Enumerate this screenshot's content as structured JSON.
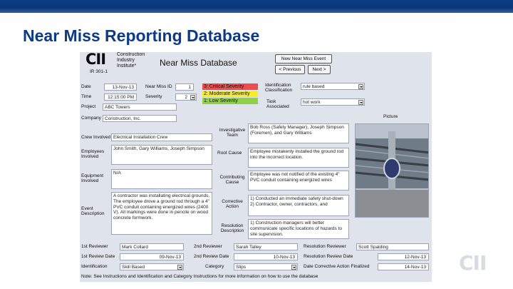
{
  "slide": {
    "title": "Near Miss Reporting Database",
    "corner_logo": "CII"
  },
  "header": {
    "logo_mark": "CII",
    "logo_lines": [
      "Construction",
      "Industry",
      "Institute*"
    ],
    "form_code": "IR 301-1",
    "form_title": "Near Miss Database",
    "buttons": {
      "new_event": "New Near Miss Event",
      "previous": "< Previous",
      "next": "Next >"
    }
  },
  "fields": {
    "date_label": "Date",
    "date": "13-Nov-13",
    "near_miss_id_label": "Near Miss ID",
    "near_miss_id": "1",
    "time_label": "Time",
    "time": "12:15:00 PM",
    "severity_label": "Severity",
    "severity": "2",
    "project_label": "Project",
    "project": "ABC Towers",
    "company_label": "Company",
    "company": "Construction, Inc.",
    "identification_classification_label": "Identification Classification",
    "identification_classification": "rule based",
    "task_associated_label": "Task Associated",
    "task_associated": "hot work"
  },
  "severity_legend": [
    {
      "label": "3: Critical Severity",
      "color": "#ef4d4d"
    },
    {
      "label": "2: Moderate Severity",
      "color": "#f7ee2a"
    },
    {
      "label": "1: Low Severity",
      "color": "#8fd247"
    }
  ],
  "picture": {
    "label": "Picture"
  },
  "left_column": {
    "crew_involved_label": "Crew Involved",
    "crew_involved": "Electrical Installation Crew",
    "employees_involved_label": "Employees Involved",
    "employees_involved": "John Smith, Gary Williams, Joseph Simpson",
    "equipment_involved_label": "Equipment Involved",
    "equipment_involved": "N/A",
    "event_description_label": "Event Description",
    "event_description": "A contractor was installating electrical grounds. The employee drove a ground rod through a 4\" PVC conduit containing energized wires (2400 V). All markings were done in pencile on wood concrete formwork."
  },
  "middle_column": {
    "investigative_team_label": "Investigative Team",
    "investigative_team": "Bob Ross (Safety Manager), Joseph Simpson (Foremen), and Gary Williams",
    "root_cause_label": "Root Cause",
    "root_cause": "Employee mistakenly installed the ground rod into the incorrect location.",
    "contributing_cause_label": "Contributing Cause",
    "contributing_cause": "Employee was not notified of the existing 4\" PVC conduit containing energized wires",
    "corrective_action_label": "Corrective Action",
    "corrective_action": "1) Conducted an immediate safety shut-down\n2) Contractor, owner, contractors, and",
    "resolution_description_label": "Resolution Description",
    "resolution_description": "1) Construction managers will better communicate specific locations of hazards to site supervision."
  },
  "review": {
    "first_reviewer_label": "1st Reviewer",
    "first_reviewer": "Mark Collard",
    "second_reviewer_label": "2nd Reviewer",
    "second_reviewer": "Sarah Talley",
    "resolution_reviewer_label": "Resolution Reviewer",
    "resolution_reviewer": "Scott Spalding",
    "first_review_date_label": "1st Review Date",
    "first_review_date": "09-Nov-13",
    "second_review_date_label": "2nd Review Date",
    "second_review_date": "10-Nov-13",
    "resolution_review_date_label": "Resolution Review Date",
    "resolution_review_date": "12-Nov-13",
    "identification_label": "Identification",
    "identification": "Skill Based",
    "category_label": "Category",
    "category": "Slips",
    "corrective_action_finalized_label": "Date Corrective Action Finalized",
    "corrective_action_finalized": "14-Nov-13"
  },
  "note": "Note: See Instructions and Identification and Category Instructions for more information on how to use the database"
}
